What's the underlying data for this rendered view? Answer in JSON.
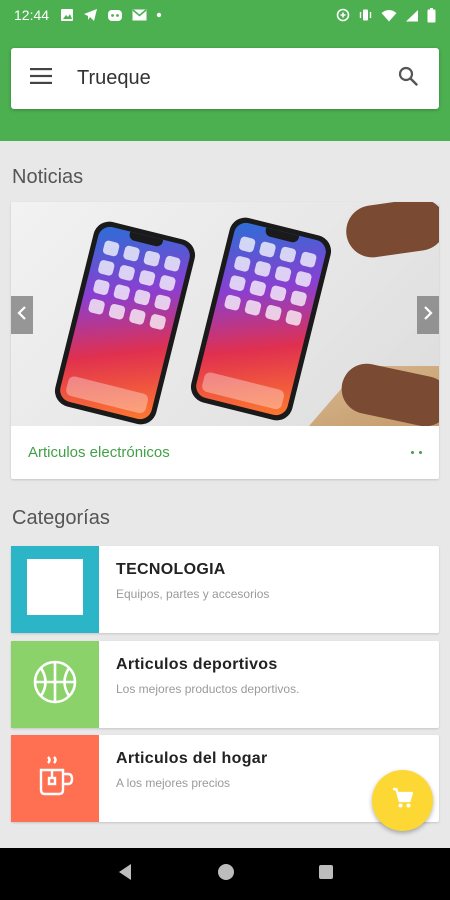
{
  "status_bar": {
    "time": "12:44",
    "left_icons": [
      "image-icon",
      "telegram-icon",
      "discord-icon",
      "gmail-icon",
      "dot-icon"
    ],
    "right_icons": [
      "data-saver-icon",
      "vibrate-icon",
      "wifi-icon",
      "signal-icon",
      "battery-icon"
    ]
  },
  "app_bar": {
    "title": "Trueque",
    "menu_icon": "menu-icon",
    "search_icon": "search-icon",
    "color": "#4caf50"
  },
  "news": {
    "heading": "Noticias",
    "caption": "Articulos electrónicos",
    "accent": "#43a047"
  },
  "categories": {
    "heading": "Categorías",
    "items": [
      {
        "title": "TECNOLOGIA",
        "subtitle": "Equipos, partes y accesorios",
        "color": "#2bb5c6",
        "icon": "blank-square-icon"
      },
      {
        "title": "Articulos deportivos",
        "subtitle": "Los mejores productos deportivos.",
        "color": "#8bd26a",
        "icon": "basketball-icon"
      },
      {
        "title": "Articulos del hogar",
        "subtitle": "A los mejores precios",
        "color": "#ff7052",
        "icon": "mug-icon"
      }
    ]
  },
  "fab": {
    "icon": "cart-icon",
    "color": "#fdd835"
  },
  "nav_bar": {
    "icons": [
      "back-icon",
      "home-icon",
      "recents-icon"
    ]
  }
}
